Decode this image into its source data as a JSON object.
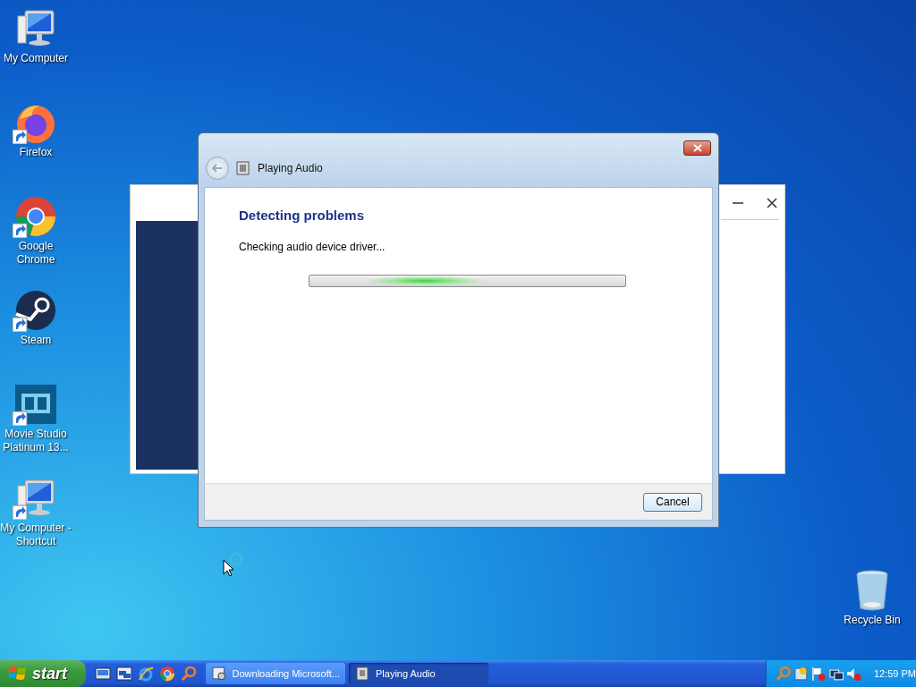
{
  "desktop_icons": [
    {
      "label": "My Computer",
      "kind": "computer",
      "shortcut": false
    },
    {
      "label": "Firefox",
      "kind": "firefox",
      "shortcut": true
    },
    {
      "label": "Google Chrome",
      "kind": "chrome",
      "shortcut": true
    },
    {
      "label": "Steam",
      "kind": "steam",
      "shortcut": true
    },
    {
      "label": "Movie Studio Platinum 13...",
      "kind": "film",
      "shortcut": true
    },
    {
      "label": "My Computer - Shortcut",
      "kind": "computer",
      "shortcut": true
    }
  ],
  "recycle_bin": {
    "label": "Recycle Bin"
  },
  "dialog": {
    "title": "Playing Audio",
    "heading": "Detecting problems",
    "status": "Checking audio device driver...",
    "progress": {
      "level": 0.36
    },
    "buttons": [
      "Cancel"
    ]
  },
  "taskbar": {
    "start": "start",
    "quick_launch": [
      {
        "kind": "desktop"
      },
      {
        "kind": "windows"
      },
      {
        "kind": "ie"
      },
      {
        "kind": "chrome"
      },
      {
        "kind": "search"
      }
    ],
    "tasks": [
      {
        "label": "Downloading Microsoft...",
        "kind": "download",
        "selected": false
      },
      {
        "label": "Playing Audio",
        "kind": "dialog",
        "selected": true
      }
    ],
    "tray": [
      {
        "kind": "search"
      },
      {
        "kind": "update"
      },
      {
        "kind": "flag"
      },
      {
        "kind": "network"
      },
      {
        "kind": "volume"
      }
    ],
    "clock": "12:59 PM"
  }
}
